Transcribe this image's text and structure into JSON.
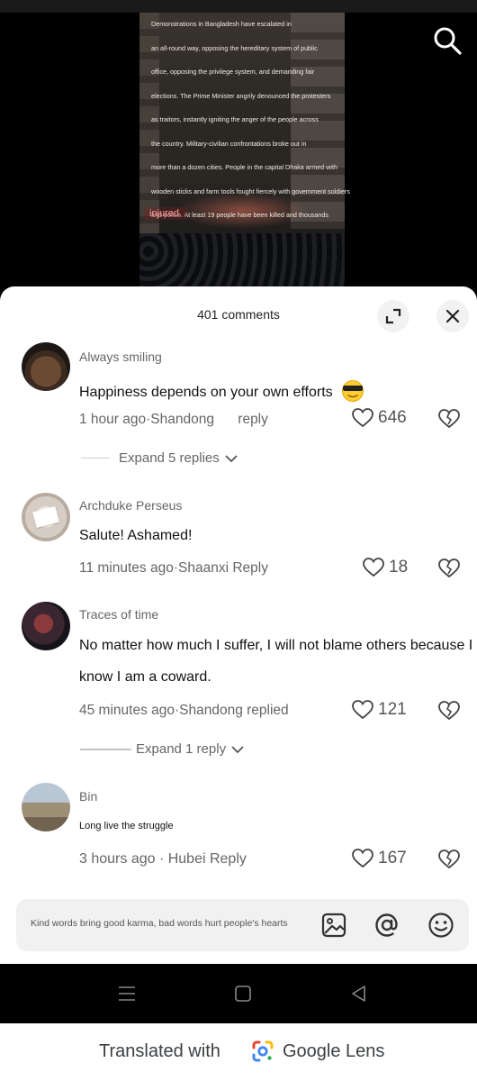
{
  "video": {
    "caption_lines": [
      "Demonstrations in Bangladesh have escalated in",
      "an all-round way, opposing the hereditary system of public",
      "office, opposing the privilege system, and demanding fair",
      "elections. The Prime Minister angrily denounced the protesters",
      "as traitors, instantly igniting the anger of the people across",
      "the country. Military-civilian confrontations broke out in",
      "more than a dozen cities. People in the capital Dhaka armed with",
      "wooden sticks and farm tools fought fiercely with government soldiers",
      "and police. At least 19 people have been killed and thousands"
    ],
    "caption_last": "injured.",
    "search_icon": "search-icon"
  },
  "sheet": {
    "comment_count": "401 comments",
    "expand_icon": "expand-icon",
    "close_icon": "close-icon"
  },
  "comments": [
    {
      "user": "Always smiling",
      "text": "Happiness depends on your own efforts",
      "emoji": "cool-face-emoji",
      "meta": "1 hour ago·Shandong",
      "reply_label": "reply",
      "likes": "646",
      "expand_label": "Expand 5 replies"
    },
    {
      "user": "Archduke Perseus",
      "text": "Salute! Ashamed!",
      "meta": "11 minutes ago·Shaanxi Reply",
      "likes": "18"
    },
    {
      "user": "Traces of time",
      "text_line1": "No matter how much I suffer, I will not blame others because I",
      "text_line2": "know I am a coward.",
      "meta": "45 minutes ago·Shandong replied",
      "likes": "121",
      "expand_label": "Expand 1 reply"
    },
    {
      "user": "Bin",
      "text": "Long live the struggle",
      "meta": "3 hours ago · Hubei Reply",
      "likes": "167"
    }
  ],
  "input": {
    "placeholder": "Kind words bring good karma, bad words hurt people's hearts",
    "icons": [
      "image-icon",
      "at-mention-icon",
      "emoji-icon"
    ]
  },
  "nav": {
    "icons": [
      "recents-icon",
      "home-icon",
      "back-icon"
    ]
  },
  "lens": {
    "text": "Translated with",
    "brand": "Google Lens"
  },
  "colors": {
    "sheet_bg": "#ffffff",
    "text_primary": "#111111",
    "text_secondary": "#666666",
    "input_bg": "#f1f1f2"
  }
}
